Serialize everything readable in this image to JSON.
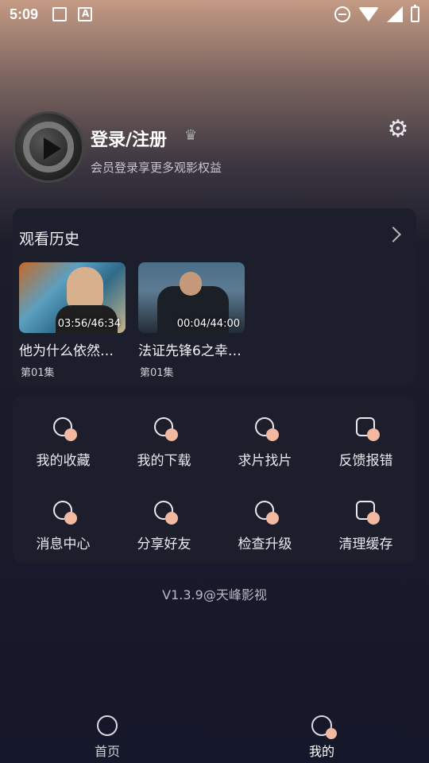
{
  "status_bar": {
    "time": "5:09"
  },
  "profile": {
    "title": "登录/注册",
    "subtitle": "会员登录享更多观影权益"
  },
  "history": {
    "title": "观看历史",
    "items": [
      {
        "title": "他为什么依然…",
        "episode": "第01集",
        "duration": "03:56/46:34"
      },
      {
        "title": "法证先锋6之幸…",
        "episode": "第01集",
        "duration": "00:04/44:00"
      }
    ]
  },
  "functions": [
    {
      "label": "我的收藏",
      "icon": "heart-icon"
    },
    {
      "label": "我的下载",
      "icon": "download-icon"
    },
    {
      "label": "求片找片",
      "icon": "search-film-icon"
    },
    {
      "label": "反馈报错",
      "icon": "feedback-icon"
    },
    {
      "label": "消息中心",
      "icon": "bell-icon"
    },
    {
      "label": "分享好友",
      "icon": "share-icon"
    },
    {
      "label": "检查升级",
      "icon": "upgrade-icon"
    },
    {
      "label": "清理缓存",
      "icon": "clean-cache-icon"
    }
  ],
  "version": "V1.3.9@天峰影视",
  "bottom_nav": {
    "items": [
      {
        "label": "首页",
        "icon": "home-icon"
      },
      {
        "label": "我的",
        "icon": "profile-icon"
      }
    ],
    "active_index": 1
  }
}
